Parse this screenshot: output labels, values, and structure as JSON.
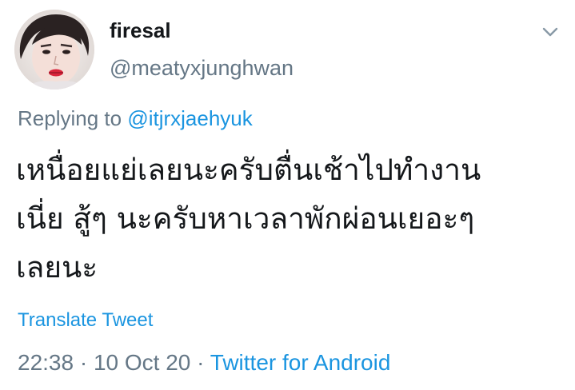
{
  "user": {
    "display_name": "firesal",
    "handle": "@meatyxjunghwan",
    "avatar_icon": "profile-photo"
  },
  "reply": {
    "prefix": "Replying to",
    "target": "@itjrxjaehyuk"
  },
  "tweet": {
    "lines": [
      "เหนื่อยแย่เลยนะครับตื่นเช้าไปทำงาน",
      "เนี่ย สู้ๆ นะครับหาเวลาพักผ่อนเยอะๆ",
      "เลยนะ"
    ]
  },
  "translate_label": "Translate Tweet",
  "meta": {
    "time": "22:38",
    "separator": "·",
    "date": "10 Oct 20",
    "source": "Twitter for Android"
  },
  "menu_icon": "chevron-down-icon",
  "colors": {
    "link": "#1b95e0",
    "secondary": "#657786",
    "primary": "#14171a"
  }
}
